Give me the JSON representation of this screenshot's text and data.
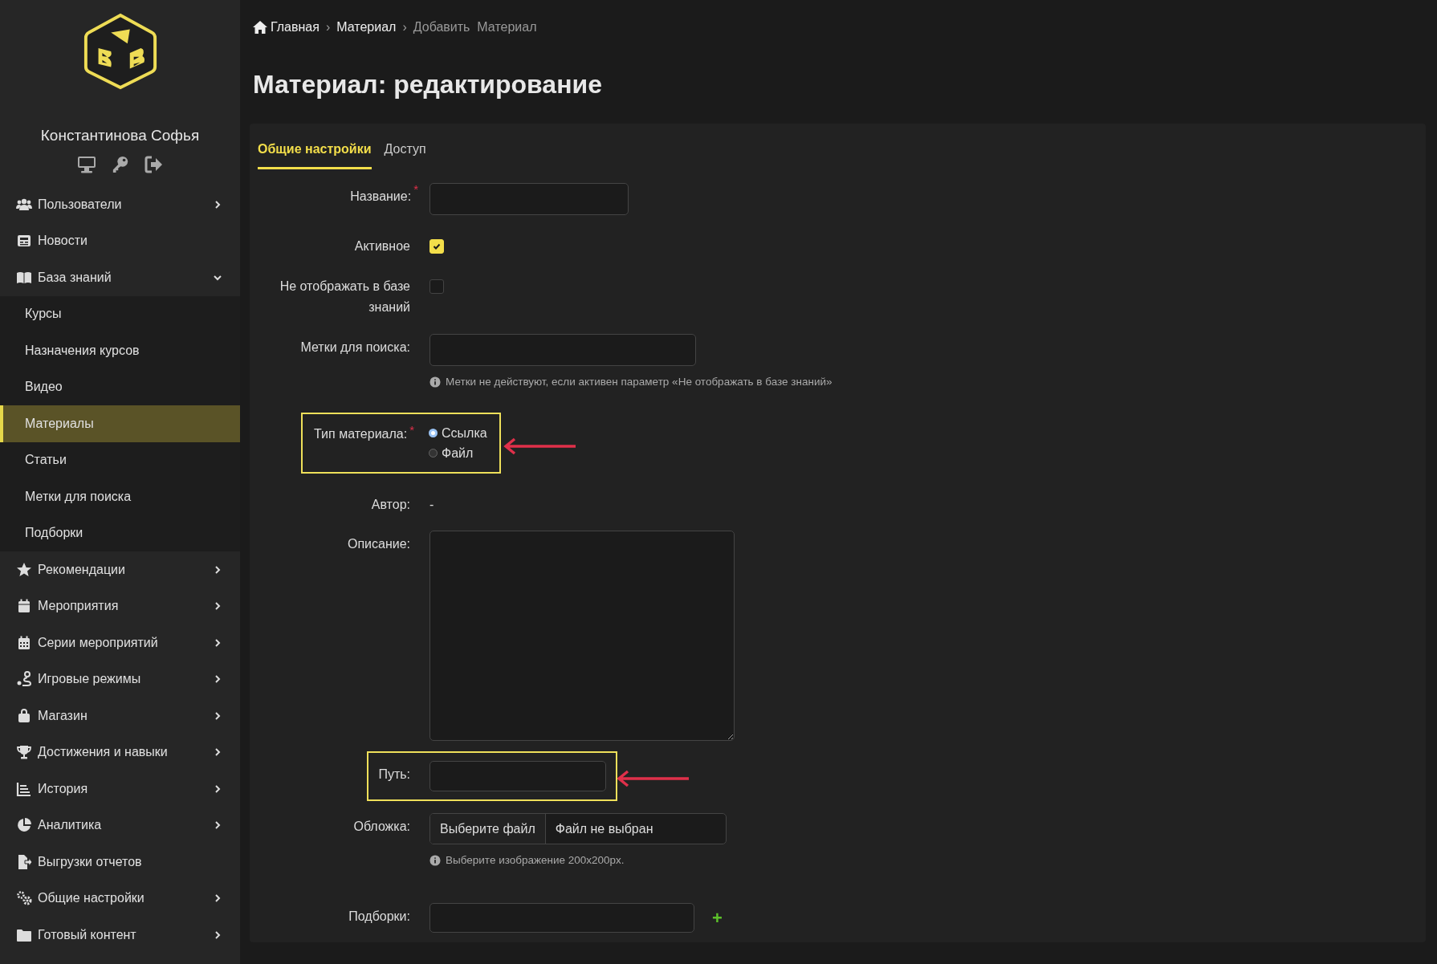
{
  "sidebar": {
    "user_name": "Константинова Софья",
    "menu": [
      {
        "label": "Пользователи",
        "expanded": false
      },
      {
        "label": "Новости"
      },
      {
        "label": "База знаний",
        "expanded": true,
        "children": [
          {
            "label": "Курсы",
            "selected": false
          },
          {
            "label": "Назначения курсов",
            "selected": false
          },
          {
            "label": "Видео",
            "selected": false
          },
          {
            "label": "Материалы",
            "selected": true
          },
          {
            "label": "Статьи",
            "selected": false
          },
          {
            "label": "Метки для поиска",
            "selected": false
          },
          {
            "label": "Подборки",
            "selected": false
          }
        ]
      },
      {
        "label": "Рекомендации",
        "expanded": false
      },
      {
        "label": "Мероприятия",
        "expanded": false
      },
      {
        "label": "Серии мероприятий",
        "expanded": false
      },
      {
        "label": "Игровые режимы",
        "expanded": false
      },
      {
        "label": "Магазин",
        "expanded": false
      },
      {
        "label": "Достижения и навыки",
        "expanded": false
      },
      {
        "label": "История",
        "expanded": false
      },
      {
        "label": "Аналитика",
        "expanded": false
      },
      {
        "label": "Выгрузки отчетов"
      },
      {
        "label": "Общие настройки",
        "expanded": false
      },
      {
        "label": "Готовый контент",
        "expanded": false
      }
    ]
  },
  "breadcrumb": [
    {
      "kind": "link",
      "label": "Главная"
    },
    {
      "kind": "separator",
      "label": "›"
    },
    {
      "kind": "link",
      "label": "Материал"
    },
    {
      "kind": "separator",
      "label": "›"
    },
    {
      "kind": "current",
      "label": "Добавить  Материал"
    }
  ],
  "page_title": "Материал: редактирование",
  "tabs": [
    {
      "label": "Общие настройки",
      "selected": true
    },
    {
      "label": "Доступ",
      "selected": false
    }
  ],
  "form": [
    {
      "kind": "text",
      "label": "Название:",
      "required_mark": "*"
    },
    {
      "kind": "checkbox",
      "label": "Активное",
      "checked": true
    },
    {
      "kind": "checkbox",
      "label": "Не отображать в базе знаний",
      "checked": false
    },
    {
      "kind": "text",
      "label": "Метки для поиска:",
      "hint": "Метки не действуют, если активен параметр «Не отображать в базе знаний»"
    },
    {
      "kind": "radio",
      "label": "Тип материала:",
      "required_mark": "*",
      "highlighted": true,
      "options": [
        {
          "label": "Ссылка",
          "selected": true
        },
        {
          "label": "Файл",
          "selected": false
        }
      ]
    },
    {
      "kind": "static",
      "label": "Автор:",
      "value": "-"
    },
    {
      "kind": "textarea",
      "label": "Описание:"
    },
    {
      "kind": "text",
      "label": "Путь:",
      "highlighted": true
    },
    {
      "kind": "file",
      "label": "Обложка:",
      "button": "Выберите файл",
      "status": "Файл не выбран",
      "hint": "Выберите изображение 200x200px."
    },
    {
      "kind": "select",
      "label": "Подборки:",
      "add": "+"
    }
  ]
}
